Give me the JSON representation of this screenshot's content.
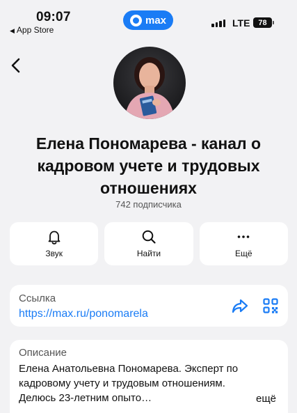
{
  "status_bar": {
    "time": "09:07",
    "back_app": "App Store",
    "pill_label": "max",
    "network": "LTE",
    "battery": "78"
  },
  "channel": {
    "title": "Елена Пономарева - канал о кадровом учете и трудовых отношениях",
    "subscribers": "742 подписчика"
  },
  "actions": [
    {
      "label": "Звук",
      "icon": "bell-icon"
    },
    {
      "label": "Найти",
      "icon": "search-icon"
    },
    {
      "label": "Ещё",
      "icon": "more-icon"
    }
  ],
  "link": {
    "label": "Ссылка",
    "url": "https://max.ru/ponomarela"
  },
  "description": {
    "label": "Описание",
    "text": "Елена Анатольевна Пономарева. Эксперт по кадровому учету и трудовым отношениям. Делюсь 23-летним опыто…",
    "more": "ещё"
  },
  "colors": {
    "accent": "#1a7cf5",
    "background": "#f2f2f4",
    "card": "#ffffff"
  }
}
